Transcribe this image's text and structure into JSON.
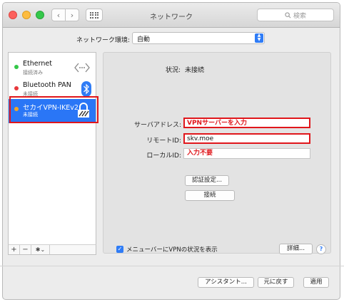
{
  "window": {
    "title": "ネットワーク"
  },
  "toolbar": {
    "search_placeholder": "検索"
  },
  "location": {
    "label": "ネットワーク環境:",
    "value": "自動"
  },
  "services": [
    {
      "name": "Ethernet",
      "status": "接続済み",
      "dot_color": "#33c748",
      "icon": "ethernet-arrows-icon"
    },
    {
      "name": "Bluetooth PAN",
      "status": "未接続",
      "dot_color": "#e8393c",
      "icon": "bluetooth-icon"
    },
    {
      "name": "セカイVPN-IKEv2",
      "status": "未接続",
      "dot_color": "#f0a429",
      "icon": "vpn-lock-icon"
    }
  ],
  "sidebar_tools": {
    "add": "+",
    "remove": "−",
    "action": "✱⌄"
  },
  "detail": {
    "status_label": "状況:",
    "status_value": "未接続",
    "server_label": "サーバアドレス:",
    "server_value": "VPNサーバーを入力",
    "remote_label": "リモートID:",
    "remote_value": "skv.moe",
    "local_label": "ローカルID:",
    "local_value": "入力不要",
    "auth_button": "認証設定...",
    "connect_button": "接続",
    "menubar_checkbox": "メニューバーにVPNの状況を表示",
    "menubar_checked": true,
    "advanced_button": "詳細...",
    "help": "?"
  },
  "footer": {
    "assistant": "アシスタント...",
    "revert": "元に戻す",
    "apply": "適用"
  },
  "colors": {
    "highlight": "#e0161b",
    "selection": "#2a76f6",
    "accent": "#2f7cf6"
  }
}
